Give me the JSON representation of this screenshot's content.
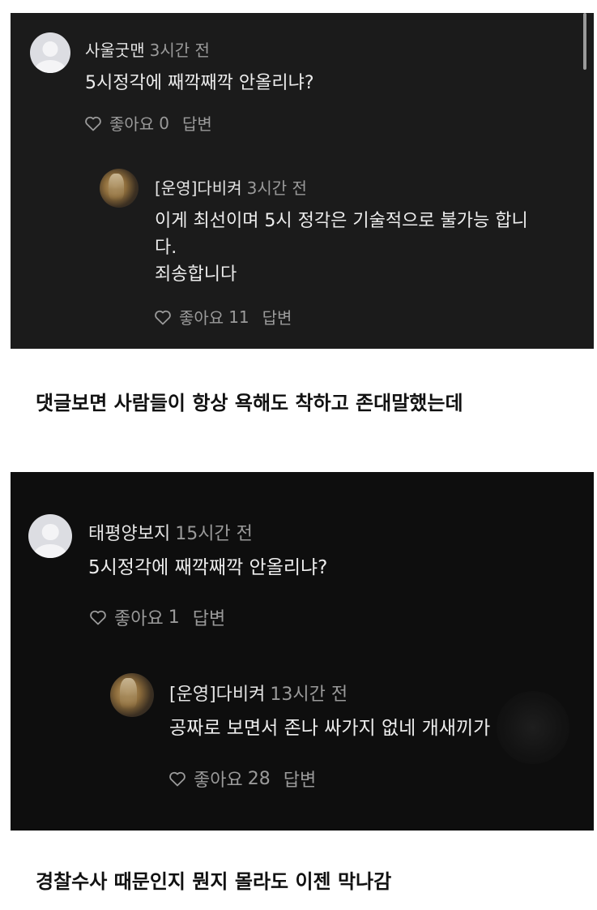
{
  "shot1": {
    "comment": {
      "author": "사울굿맨",
      "time": "3시간 전",
      "text": "5시정각에 째깍째깍 안올리냐?",
      "likes_label": "좋아요",
      "likes_count": "0",
      "reply_label": "답변"
    },
    "reply": {
      "author": "[운영]다비켜",
      "time": "3시간 전",
      "text": "이게 최선이며 5시 정각은 기술적으로 불가능 합니\n다.\n죄송합니다",
      "likes_label": "좋아요",
      "likes_count": "11",
      "reply_label": "답변"
    }
  },
  "caption1": "댓글보면 사람들이 항상 욕해도 착하고 존대말했는데",
  "shot2": {
    "comment": {
      "author": "태평양보지",
      "time": "15시간 전",
      "text": "5시정각에 째깍째깍 안올리냐?",
      "likes_label": "좋아요",
      "likes_count": "1",
      "reply_label": "답변"
    },
    "reply": {
      "author": "[운영]다비켜",
      "time": "13시간 전",
      "text": "공짜로 보면서 존나 싸가지 없네 개새끼가",
      "likes_label": "좋아요",
      "likes_count": "28",
      "reply_label": "답변"
    }
  },
  "caption2": "경찰수사 때문인지 뭔지 몰라도 이젠 막나감",
  "icons": {
    "like": "heart-outline-icon",
    "avatar_default": "default-user-avatar",
    "avatar_photo": "user-photo-avatar"
  },
  "colors": {
    "panel_bg": "#1b1b1b",
    "panel_bg_2": "#0e0e0e",
    "text_primary": "#ededed",
    "text_secondary": "#9a9a9a",
    "caption_text": "#111111"
  }
}
